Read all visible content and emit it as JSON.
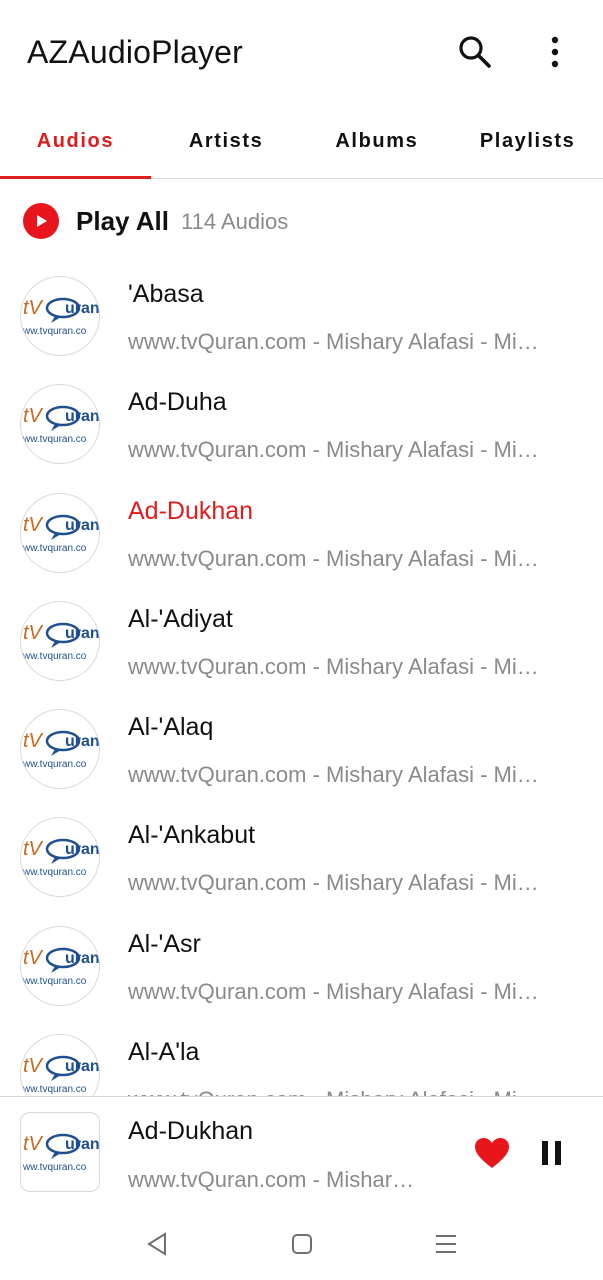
{
  "app": {
    "title": "AZAudioPlayer"
  },
  "icons": {
    "search": "search-icon",
    "more": "more-vert-icon",
    "play": "play-icon",
    "heart": "heart-icon",
    "pause": "pause-icon"
  },
  "tabs": [
    {
      "label": "Audios",
      "active": true
    },
    {
      "label": "Artists",
      "active": false
    },
    {
      "label": "Albums",
      "active": false
    },
    {
      "label": "Playlists",
      "active": false
    }
  ],
  "play_all": {
    "label": "Play All",
    "count": "114 Audios"
  },
  "thumbnail": {
    "brand_left": "tV",
    "brand_right": "uran",
    "url_text": "ww.tvquran.co"
  },
  "songs": [
    {
      "title": "'Abasa",
      "subtitle": "www.tvQuran.com - Mishary Alafasi - Mishary Alafasi",
      "playing": false
    },
    {
      "title": "Ad-Duha",
      "subtitle": "www.tvQuran.com - Mishary Alafasi - Mishary Alafasi",
      "playing": false
    },
    {
      "title": "Ad-Dukhan",
      "subtitle": "www.tvQuran.com - Mishary Alafasi - Mishary Alafasi",
      "playing": true
    },
    {
      "title": "Al-'Adiyat",
      "subtitle": "www.tvQuran.com - Mishary Alafasi - Mishary Alafasi",
      "playing": false
    },
    {
      "title": "Al-'Alaq",
      "subtitle": "www.tvQuran.com - Mishary Alafasi - Mishary Alafasi",
      "playing": false
    },
    {
      "title": "Al-'Ankabut",
      "subtitle": "www.tvQuran.com - Mishary Alafasi - Mishary Alafasi",
      "playing": false
    },
    {
      "title": "Al-'Asr",
      "subtitle": "www.tvQuran.com - Mishary Alafasi - Mishary Alafasi",
      "playing": false
    },
    {
      "title": "Al-A'la",
      "subtitle": "www.tvQuran.com - Mishary Alafasi - Mishary Alafasi",
      "playing": false
    }
  ],
  "now_playing": {
    "title": "Ad-Dukhan",
    "subtitle": "www.tvQuran.com - Mishary Alafasi - Mishary Alafasi",
    "liked": true
  },
  "colors": {
    "accent": "#e01d1d",
    "text_primary": "#111111",
    "text_secondary": "#8a8a8a",
    "brand_orange": "#c8691f",
    "brand_blue": "#1f4f8f"
  }
}
